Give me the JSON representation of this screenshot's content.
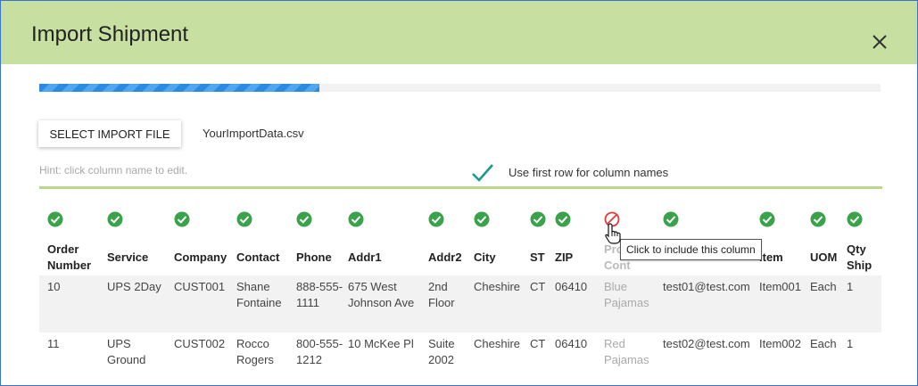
{
  "dialog": {
    "title": "Import Shipment",
    "progress_fraction": 0.333
  },
  "file": {
    "select_label": "SELECT IMPORT FILE",
    "filename": "YourImportData.csv"
  },
  "hint": "Hint: click column name to edit.",
  "first_row_option": {
    "label": "Use first row for column names",
    "checked": true
  },
  "tooltip": "Click to include this column",
  "colors": {
    "header_bg": "#c7e0a1",
    "included": "#3aa24a",
    "excluded": "#e23b3b",
    "progress": "#2c8be0"
  },
  "columns": [
    {
      "name": "Order Number",
      "included": true
    },
    {
      "name": "Service",
      "included": true
    },
    {
      "name": "Company",
      "included": true
    },
    {
      "name": "Contact",
      "included": true
    },
    {
      "name": "Phone",
      "included": true
    },
    {
      "name": "Addr1",
      "included": true
    },
    {
      "name": "Addr2",
      "included": true
    },
    {
      "name": "City",
      "included": true
    },
    {
      "name": "ST",
      "included": true
    },
    {
      "name": "ZIP",
      "included": true
    },
    {
      "name": "Prod Cont",
      "included": false
    },
    {
      "name": "",
      "included": true
    },
    {
      "name": "Item",
      "included": true
    },
    {
      "name": "UOM",
      "included": true
    },
    {
      "name": "Qty Ship",
      "included": true
    }
  ],
  "rows": [
    [
      "10",
      "UPS 2Day",
      "CUST001",
      "Shane Fontaine",
      "888-555-1111",
      "675 West Johnson Ave",
      "2nd Floor",
      "Cheshire",
      "CT",
      "06410",
      "Blue Pajamas",
      "test01@test.com",
      "Item001",
      "Each",
      "1"
    ],
    [
      "11",
      "UPS Ground",
      "CUST002",
      "Rocco Rogers",
      "800-555-1212",
      "10 McKee Pl",
      "Suite 2002",
      "Cheshire",
      "CT",
      "06410",
      "Red Pajamas",
      "test02@test.com",
      "Item002",
      "Each",
      "1"
    ]
  ]
}
